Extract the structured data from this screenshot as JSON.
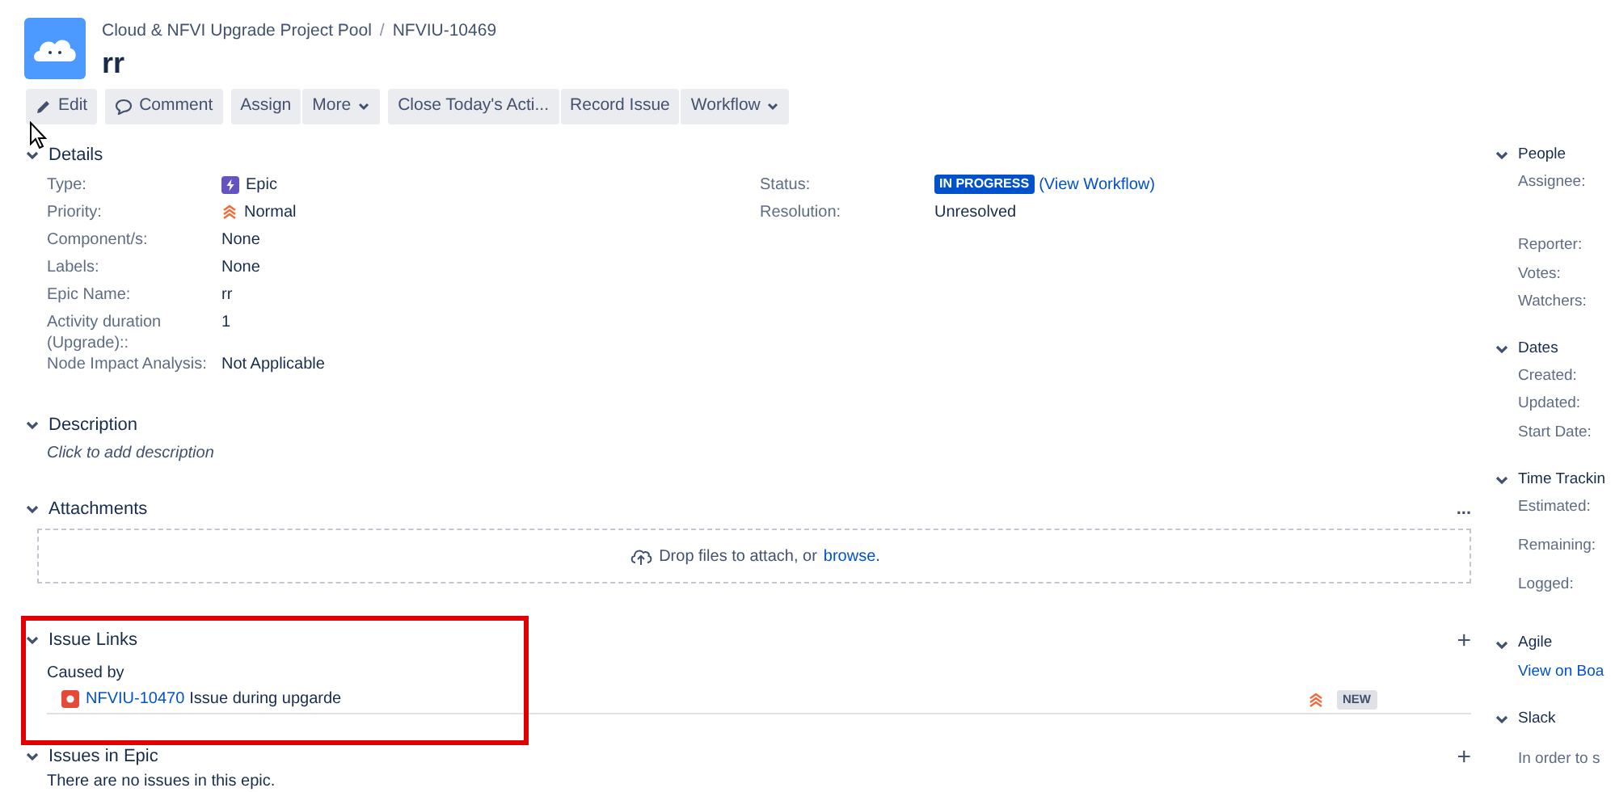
{
  "header": {
    "project": "Cloud & NFVI Upgrade Project Pool",
    "separator": "/",
    "issue_key": "NFVIU-10469",
    "title": "rr"
  },
  "toolbar": [
    [
      {
        "label": "Edit",
        "kind": "pencil"
      }
    ],
    [
      {
        "label": "Comment",
        "kind": "bubble"
      }
    ],
    [
      {
        "label": "Assign",
        "kind": "plain"
      },
      {
        "label": "More",
        "kind": "menu"
      }
    ],
    [
      {
        "label": "Close Today's Acti...",
        "kind": "plain"
      },
      {
        "label": "Record Issue",
        "kind": "plain"
      },
      {
        "label": "Workflow",
        "kind": "menu"
      }
    ]
  ],
  "details": {
    "title": "Details",
    "expanded": true,
    "left": [
      {
        "label": "Type:",
        "value": "Epic",
        "kind": "epic"
      },
      {
        "label": "Priority:",
        "value": "Normal",
        "kind": "priority"
      },
      {
        "label": "Component/s:",
        "value": "None",
        "kind": "text"
      },
      {
        "label": "Labels:",
        "value": "None",
        "kind": "text"
      },
      {
        "label": "Epic Name:",
        "value": "rr",
        "kind": "text"
      },
      {
        "label": "Activity duration (Upgrade)::",
        "value": "1",
        "kind": "text"
      },
      {
        "label": "Node Impact Analysis:",
        "value": "Not Applicable",
        "kind": "text"
      }
    ],
    "right": [
      {
        "label": "Status:",
        "value": "IN PROGRESS",
        "link": "(View Workflow)",
        "kind": "status"
      },
      {
        "label": "Resolution:",
        "value": "Unresolved",
        "kind": "text"
      }
    ]
  },
  "description": {
    "title": "Description",
    "expanded": true,
    "placeholder": "Click to add description"
  },
  "attachments": {
    "title": "Attachments",
    "expanded": true,
    "more": "...",
    "drop_text": "Drop files to attach, or",
    "browse": "browse."
  },
  "issue_links": {
    "title": "Issue Links",
    "expanded": true,
    "add": "+",
    "relation": "Caused by",
    "links": [
      {
        "key": "NFVIU-10470",
        "summary": "Issue during upgarde",
        "status": "NEW"
      }
    ]
  },
  "issues_in_epic": {
    "title": "Issues in Epic",
    "expanded": true,
    "add": "+",
    "text": "There are no issues in this epic."
  },
  "sidebar": [
    {
      "title": "People",
      "expanded": true,
      "fields": [
        "Assignee:",
        "Reporter:",
        "Votes:",
        "Watchers:"
      ]
    },
    {
      "title": "Dates",
      "expanded": true,
      "fields": [
        "Created:",
        "Updated:",
        "Start Date:"
      ]
    },
    {
      "title": "Time Trackin",
      "expanded": true,
      "fields": [
        "Estimated:",
        "Remaining:",
        "Logged:"
      ]
    },
    {
      "title": "Agile",
      "expanded": true,
      "link": "View on Boa"
    },
    {
      "title": "Slack",
      "expanded": true,
      "text": "In order to s"
    }
  ]
}
